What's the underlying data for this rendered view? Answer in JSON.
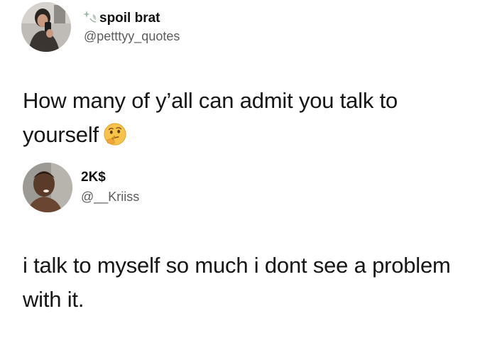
{
  "tweets": [
    {
      "display_name": "spoil brat",
      "handle": "@petttyy_quotes",
      "text": "How many of y’all can admit you talk to yourself",
      "emoji": "thinking-face"
    },
    {
      "display_name": "2K$",
      "handle": "@__Kriiss",
      "text": "i talk to myself so much i dont see a problem with it."
    }
  ]
}
